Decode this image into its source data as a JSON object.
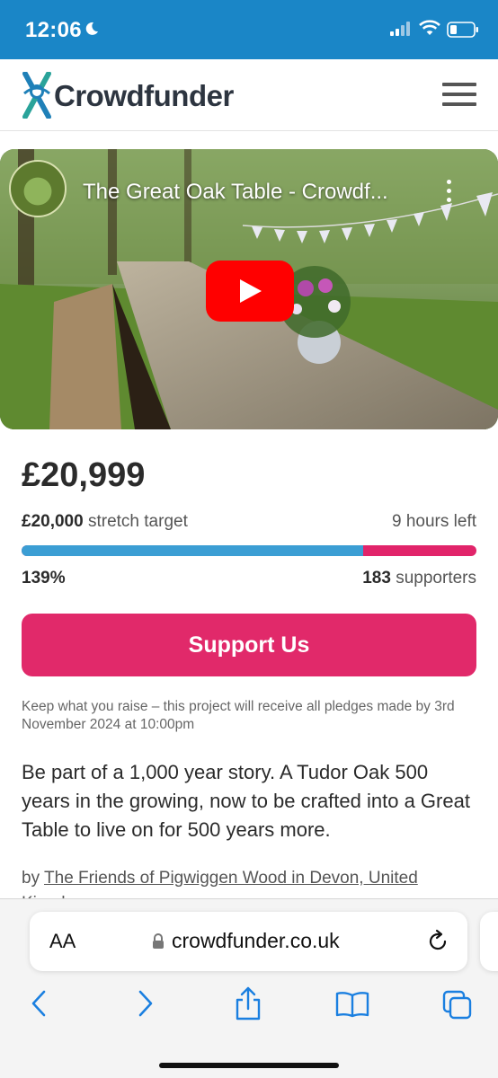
{
  "status_bar": {
    "time": "12:06"
  },
  "header": {
    "logo_text": "Crowdfunder"
  },
  "video": {
    "title": "The Great Oak Table - Crowdf..."
  },
  "project": {
    "amount_raised": "£20,999",
    "target_amount": "£20,000",
    "target_label": "stretch target",
    "time_left": "9 hours left",
    "funded_percent_label": "139%",
    "funded_fraction_first_target": 0.75,
    "supporters_count": "183",
    "supporters_label": "supporters",
    "support_button": "Support Us",
    "keep_note": "Keep what you raise – this project will receive all pledges made by 3rd November 2024 at 10:00pm",
    "tagline": "Be part of a 1,000 year story. A Tudor Oak 500 years in the growing, now to be crafted into a Great Table to live on for 500 years more.",
    "byline_prefix": "by",
    "byline_link": "The Friends of Pigwiggen Wood in Devon, United Kingdom"
  },
  "colors": {
    "status_bar": "#1a86c7",
    "progress_primary": "#3b9ed4",
    "progress_stretch": "#e1246a",
    "cta": "#e1296a",
    "logo_accent": "#2aa39a"
  },
  "browser": {
    "aa_label": "AA",
    "url": "crowdfunder.co.uk"
  }
}
